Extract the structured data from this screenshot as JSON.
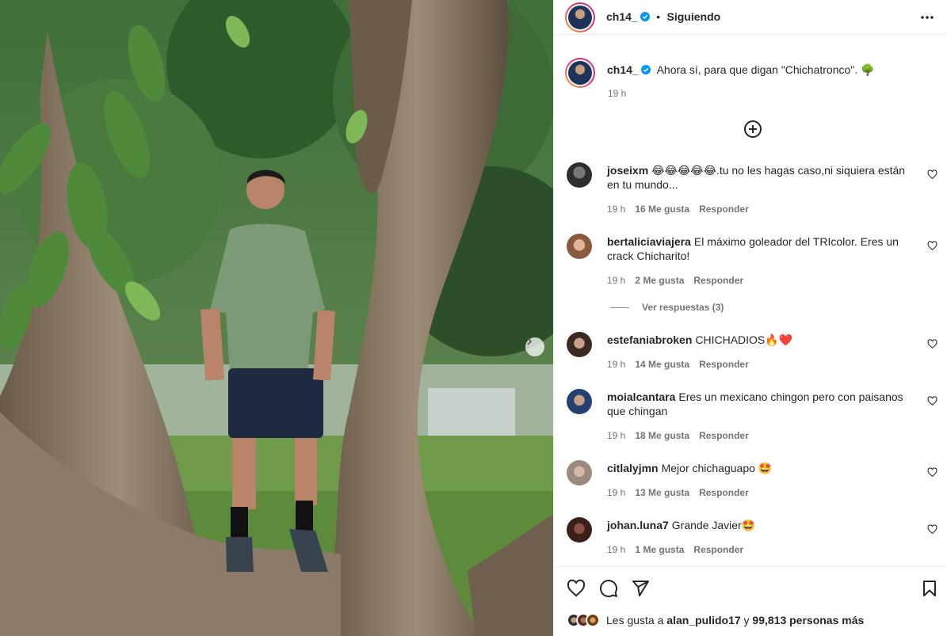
{
  "post": {
    "username": "ch14_",
    "follow_status": "Siguiendo",
    "caption": "Ahora sí, para que digan \"Chichatronco\". 🌳",
    "time": "19 h"
  },
  "comments": [
    {
      "user": "joseixm",
      "text": "😂😂😂😂😂.tu no les hagas caso,ni siquiera están en tu mundo...",
      "time": "19 h",
      "likes": "16 Me gusta",
      "reply": "Responder"
    },
    {
      "user": "bertaliciaviajera",
      "text": "El máximo goleador del TRIcolor. Eres un crack Chicharito!",
      "time": "19 h",
      "likes": "2 Me gusta",
      "reply": "Responder"
    },
    {
      "user": "estefaniabroken",
      "text": "CHICHADIOS🔥❤️",
      "time": "19 h",
      "likes": "14 Me gusta",
      "reply": "Responder"
    },
    {
      "user": "moialcantara",
      "text": "Eres un mexicano chingon pero con paisanos que chingan",
      "time": "19 h",
      "likes": "18 Me gusta",
      "reply": "Responder"
    },
    {
      "user": "citlalyjmn",
      "text": "Mejor chichaguapo 🤩",
      "time": "19 h",
      "likes": "13 Me gusta",
      "reply": "Responder"
    },
    {
      "user": "johan.luna7",
      "text": "Grande Javier🤩",
      "time": "19 h",
      "likes": "1 Me gusta",
      "reply": "Responder"
    }
  ],
  "replies_link": "Ver respuestas (3)",
  "likes_summary": {
    "prefix": "Les gusta a",
    "user": "alan_pulido17",
    "middle": "y",
    "others": "99,813 personas más"
  },
  "colors": {
    "verified": "#0095f6",
    "border": "#efefef",
    "muted": "#737373"
  },
  "icons": [
    "more-options-icon",
    "plus-circle-icon",
    "heart-icon",
    "comment-icon",
    "share-icon",
    "bookmark-icon",
    "next-arrow-icon",
    "verified-badge-icon"
  ]
}
